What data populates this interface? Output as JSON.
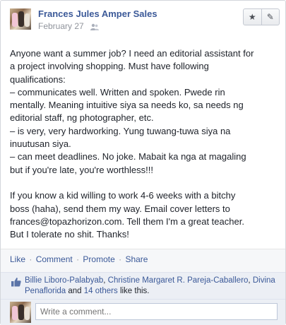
{
  "post": {
    "author": "Frances Jules Amper Sales",
    "date": "February 27",
    "audience_icon": "friends-icon",
    "lines": [
      "Anyone want a summer job? I need an editorial assistant for",
      "a project involving shopping. Must have following",
      "qualifications:",
      "– communicates well. Written and spoken. Pwede rin",
      "mentally. Meaning intuitive siya sa needs ko, sa needs ng",
      "editorial staff, ng photographer, etc.",
      "– is very, very hardworking. Yung tuwang-tuwa siya na",
      "inuutusan siya.",
      "– can meet deadlines. No joke. Mabait ka nga at magaling",
      "but if you're late, you're worthless!!!",
      "",
      "If you know a kid willing to work 4-6 weeks with a bitchy",
      "boss (haha), send them my way. Email cover letters to",
      "frances@topazhorizon.com. Tell them I'm a great teacher.",
      "But I tolerate no shit. Thanks!"
    ]
  },
  "header_buttons": {
    "star_icon": "★",
    "pencil_icon": "✎"
  },
  "actions": {
    "like": "Like",
    "comment": "Comment",
    "promote": "Promote",
    "share": "Share",
    "separator": "·"
  },
  "likes": {
    "name1": "Billie Liboro-Palabyab",
    "name2": "Christine Margaret R. Pareja-Caballero",
    "name3": "Divina Penaflorida",
    "connector": "and",
    "others": "14 others",
    "suffix": "like this.",
    "comma": ","
  },
  "comment_box": {
    "placeholder": "Write a comment..."
  },
  "colors": {
    "link": "#3b5998",
    "muted": "#90949c",
    "panel": "#eceff5"
  }
}
